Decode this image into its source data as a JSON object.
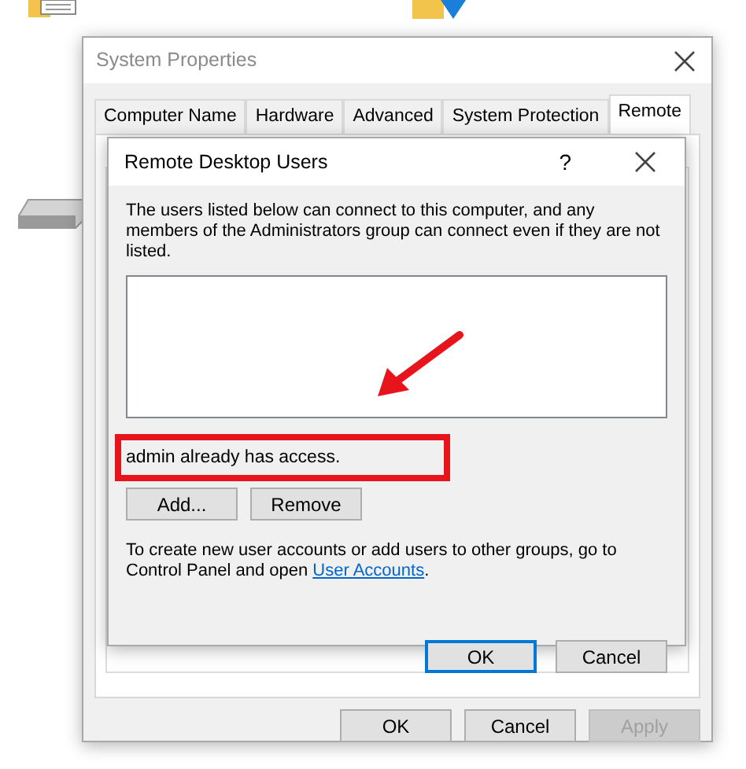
{
  "system_properties": {
    "title": "System Properties",
    "tabs": [
      {
        "label": "Computer Name",
        "selected": false
      },
      {
        "label": "Hardware",
        "selected": false
      },
      {
        "label": "Advanced",
        "selected": false
      },
      {
        "label": "System Protection",
        "selected": false
      },
      {
        "label": "Remote",
        "selected": true
      }
    ],
    "buttons": [
      {
        "label": "OK",
        "disabled": false
      },
      {
        "label": "Cancel",
        "disabled": false
      },
      {
        "label": "Apply",
        "disabled": true
      }
    ]
  },
  "remote_desktop_users": {
    "title": "Remote Desktop Users",
    "help": "?",
    "intro": "The users listed below can connect to this computer, and any members of the Administrators group can connect even if they are not listed.",
    "status": {
      "text": "admin already has access.",
      "highlighted": true
    },
    "list_buttons": [
      {
        "label": "Add..."
      },
      {
        "label": "Remove"
      }
    ],
    "footer_text": "To create new user accounts or add users to other groups, go to Control Panel and open ",
    "footer_link": "User Accounts",
    "footer_end": ".",
    "buttons": [
      {
        "label": "OK",
        "default": true
      },
      {
        "label": "Cancel",
        "default": false
      }
    ]
  }
}
